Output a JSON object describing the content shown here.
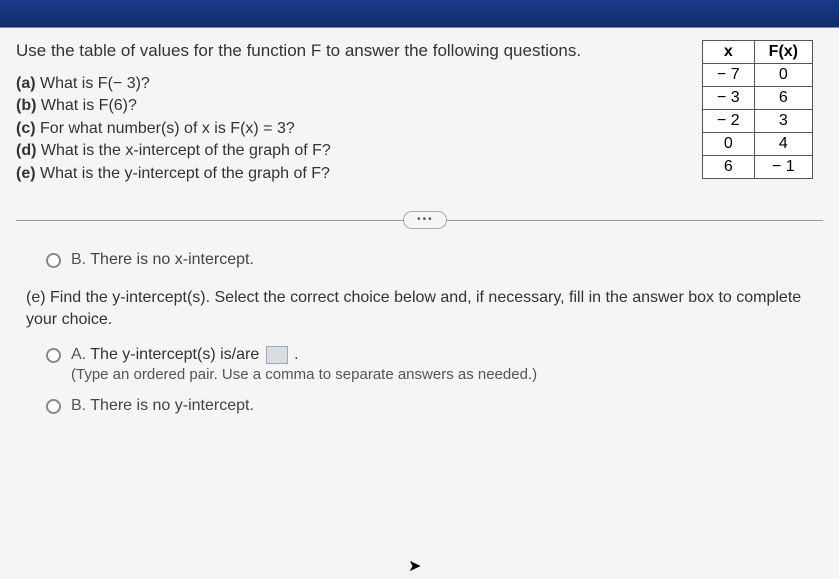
{
  "intro": "Use the table of values for the function F to answer the following questions.",
  "subquestions": {
    "a": {
      "label": "(a)",
      "text": "What is F(− 3)?"
    },
    "b": {
      "label": "(b)",
      "text": "What is F(6)?"
    },
    "c": {
      "label": "(c)",
      "text": "For what number(s) of x is F(x) = 3?"
    },
    "d": {
      "label": "(d)",
      "text": "What is the x-intercept of the graph of F?"
    },
    "e": {
      "label": "(e)",
      "text": "What is the y-intercept of the graph of F?"
    }
  },
  "table": {
    "headers": {
      "x": "x",
      "fx": "F(x)"
    },
    "rows": [
      {
        "x": "− 7",
        "fx": "0"
      },
      {
        "x": "− 3",
        "fx": "6"
      },
      {
        "x": "− 2",
        "fx": "3"
      },
      {
        "x": "0",
        "fx": "4"
      },
      {
        "x": "6",
        "fx": "− 1"
      }
    ]
  },
  "more_glyph": "•••",
  "prev_choice": {
    "letter": "B.",
    "text": "There is no x-intercept."
  },
  "part_e": {
    "prompt": "(e) Find the y-intercept(s). Select the correct choice below and, if necessary, fill in the answer box to complete your choice.",
    "choiceA": {
      "letter": "A.",
      "main_before": "The y-intercept(s) is/are ",
      "main_after": " .",
      "sub": "(Type an ordered pair. Use a comma to separate answers as needed.)"
    },
    "choiceB": {
      "letter": "B.",
      "text": "There is no y-intercept."
    }
  }
}
